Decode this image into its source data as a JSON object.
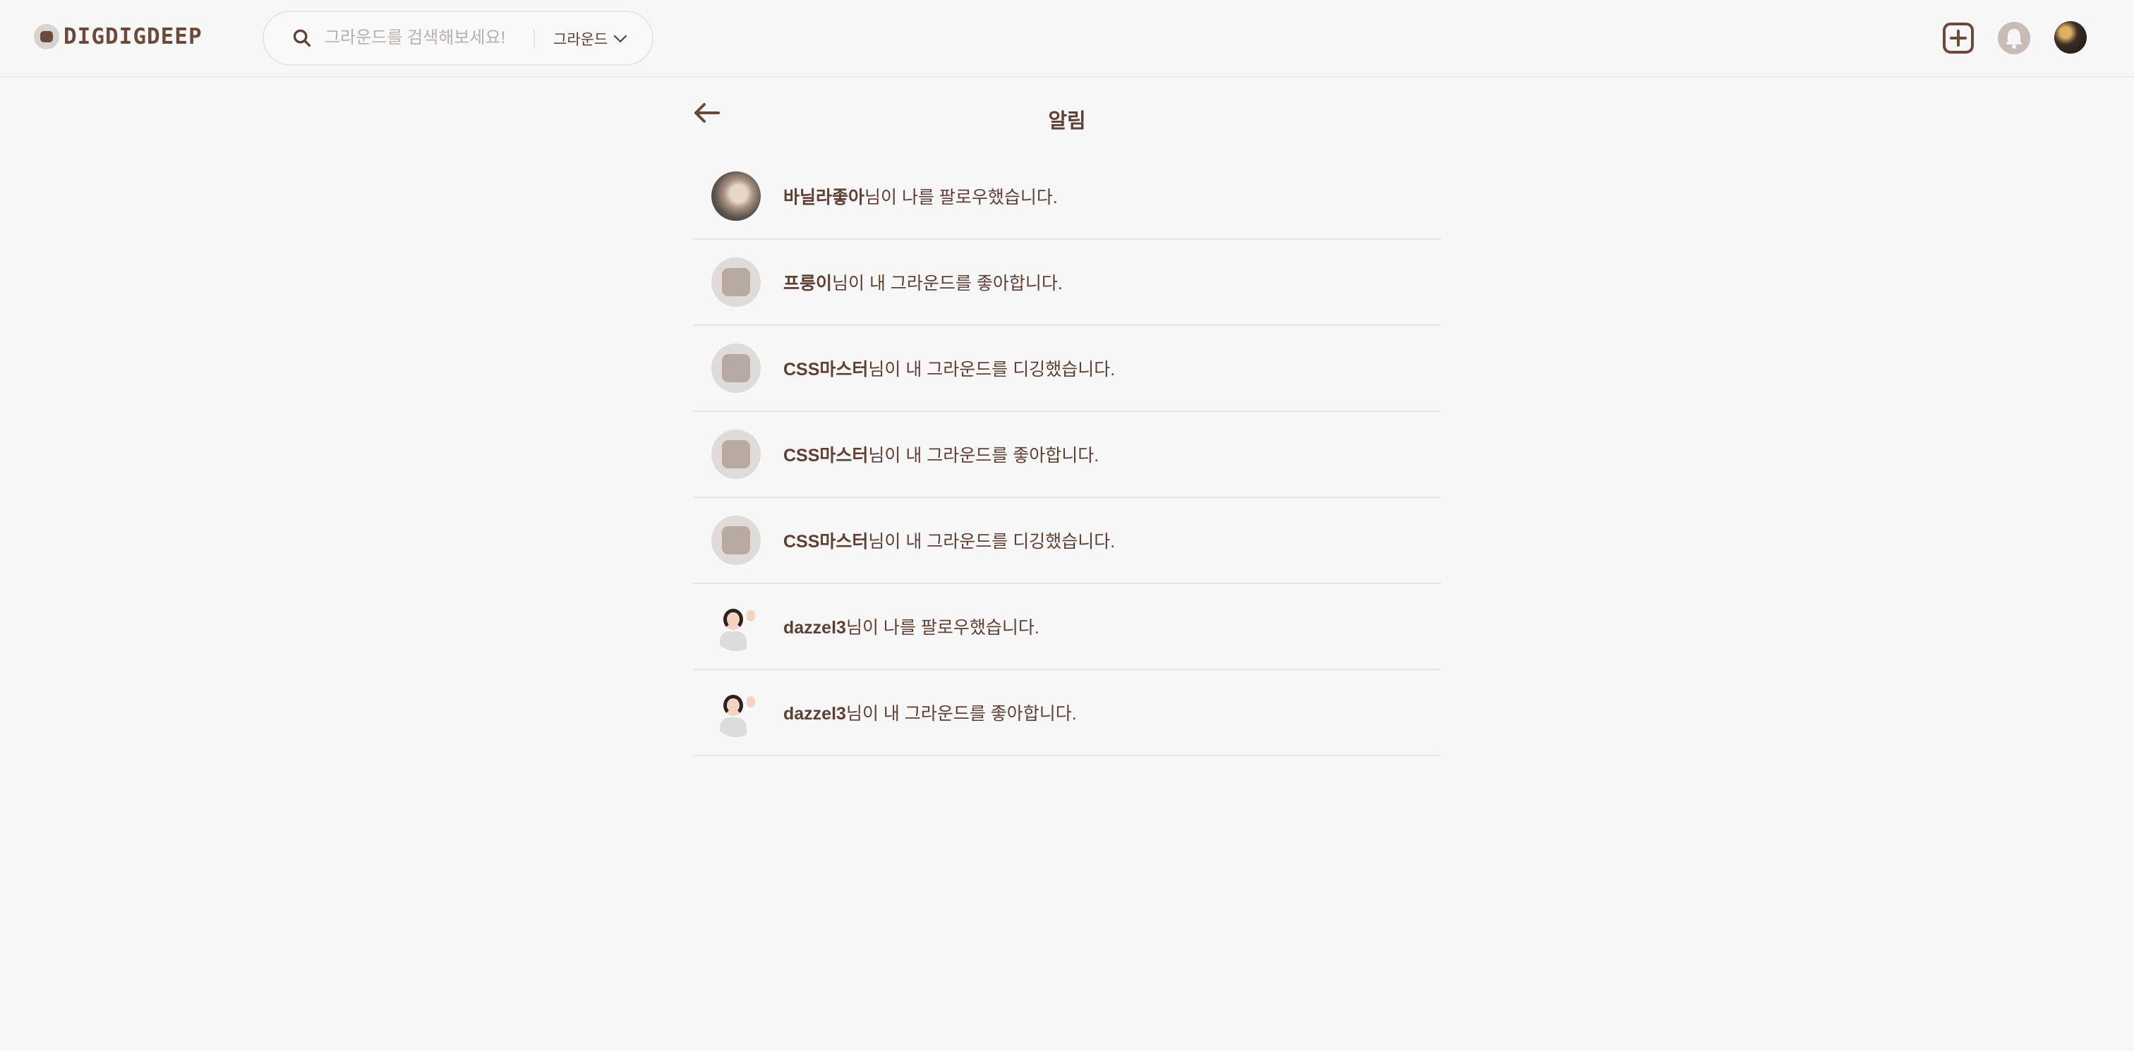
{
  "header": {
    "logo_text": "DIGDIGDEEP",
    "search": {
      "placeholder": "그라운드를 검색해보세요!",
      "value": "",
      "scope_label": "그라운드"
    }
  },
  "page": {
    "title": "알림"
  },
  "notifications": [
    {
      "user": "바닐라좋아",
      "message": "님이 나를 팔로우했습니다.",
      "avatar": "photo-dog"
    },
    {
      "user": "프룽이",
      "message": "님이 내 그라운드를 좋아합니다.",
      "avatar": "default"
    },
    {
      "user": "CSS마스터",
      "message": "님이 내 그라운드를 디깅했습니다.",
      "avatar": "default"
    },
    {
      "user": "CSS마스터",
      "message": "님이 내 그라운드를 좋아합니다.",
      "avatar": "default"
    },
    {
      "user": "CSS마스터",
      "message": "님이 내 그라운드를 디깅했습니다.",
      "avatar": "default"
    },
    {
      "user": "dazzel3",
      "message": "님이 나를 팔로우했습니다.",
      "avatar": "memoji"
    },
    {
      "user": "dazzel3",
      "message": "님이 내 그라운드를 좋아합니다.",
      "avatar": "memoji"
    }
  ],
  "colors": {
    "brand": "#6b4a3d",
    "text": "#5d3f33",
    "background": "#f7f7f7",
    "divider": "#e3e3e3"
  },
  "icons": [
    "search-icon",
    "chevron-down-icon",
    "add-square-icon",
    "bell-icon",
    "back-arrow-icon"
  ]
}
